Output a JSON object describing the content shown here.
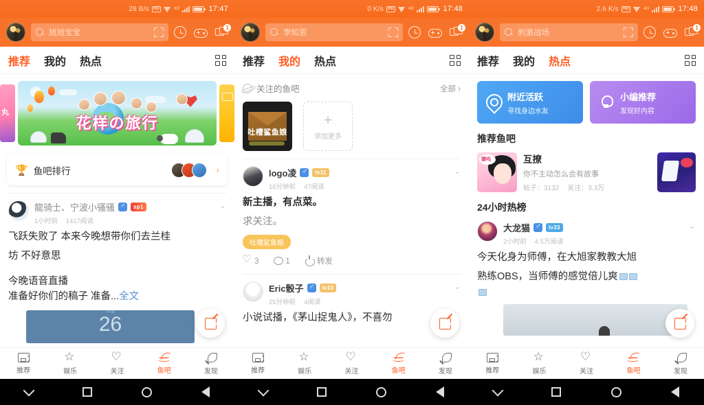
{
  "app": {
    "name": "斗鱼",
    "accent": "#FF5D23",
    "topbar_bg": "#F8732A"
  },
  "panels": [
    {
      "id": "panel-recommend",
      "status": {
        "speed": "28 B/s",
        "hd": "HD",
        "network": "4G",
        "time": "17:47",
        "battery": "88"
      },
      "topbar": {
        "search_placeholder": "旭旭宝宝",
        "message_badge": "1"
      },
      "tabs": [
        {
          "label": "推荐",
          "active": true
        },
        {
          "label": "我的",
          "active": false
        },
        {
          "label": "热点",
          "active": false
        }
      ],
      "banner": {
        "title": "花样の旅行"
      },
      "rank_card": {
        "label": "鱼吧排行",
        "chevron": "›"
      },
      "post": {
        "author": "龍骑士、宁波小骚骚",
        "gender_tag": "♂",
        "level_tag": "sp1",
        "time": "1小时前",
        "reads": "1417阅读",
        "text_line1": "飞跃失败了 本来今晚想带你们去兰桂",
        "text_line2": "坊 不好意思",
        "text_line3": "今晚语音直播",
        "text_line4": "准备好你们的稿子 准备...",
        "more_label": "全文",
        "media_number": "26"
      }
    },
    {
      "id": "panel-mine",
      "status": {
        "speed": "0 K/s",
        "hd": "HD",
        "network": "4G",
        "time": "17:48",
        "battery": "99"
      },
      "topbar": {
        "search_placeholder": "李知恩",
        "message_badge": "1"
      },
      "tabs": [
        {
          "label": "推荐",
          "active": false
        },
        {
          "label": "我的",
          "active": true
        },
        {
          "label": "热点",
          "active": false
        }
      ],
      "followed_bars": {
        "section_title": "关注的鱼吧",
        "all_label": "全部 ›",
        "items": [
          {
            "name": "吐槽鲨鱼娘"
          }
        ],
        "add_label": "添加更多",
        "add_plus": "+"
      },
      "posts": [
        {
          "author": "logo凌",
          "gender_tag": "♂",
          "level_tag": "lv11",
          "time": "16分钟前",
          "reads": "47阅读",
          "text_line1": "新主播，有点菜。",
          "text_line2": "求关注。",
          "bar_pill": "吐槽鲨鱼娘",
          "likes": "3",
          "comments": "1",
          "share_label": "转发"
        },
        {
          "author": "Eric骰子",
          "gender_tag": "♂",
          "level_tag": "lv10",
          "time": "25分钟前",
          "reads": "4阅读",
          "text_line1": "小说试播，《茅山捉鬼人》，不喜勿"
        }
      ]
    },
    {
      "id": "panel-hot",
      "status": {
        "speed": "2.6 K/s",
        "hd": "HD",
        "network": "4G",
        "time": "17:48",
        "battery": "88"
      },
      "topbar": {
        "search_placeholder": "刺激战场",
        "message_badge": "1"
      },
      "tabs": [
        {
          "label": "推荐",
          "active": false
        },
        {
          "label": "我的",
          "active": false
        },
        {
          "label": "热点",
          "active": true
        }
      ],
      "promos": [
        {
          "title": "附近活跃",
          "subtitle": "寻找身边水友",
          "color": "#4fa8f5",
          "icon": "location-pin-icon"
        },
        {
          "title": "小编推荐",
          "subtitle": "发现好内容",
          "color": "#9a6ae8",
          "icon": "lightbulb-icon"
        }
      ],
      "recommend_bars": {
        "section_title": "推荐鱼吧",
        "items": [
          {
            "name": "互撩",
            "desc": "你不主动怎么会有故事",
            "posts_label": "帖子：3132",
            "follows_label": "关注：3.3万"
          }
        ]
      },
      "hot_list": {
        "section_title": "24小时热榜",
        "post": {
          "author": "大龙猫",
          "gender_tag": "♂",
          "level_tag": "lv33",
          "time": "2小时前",
          "reads": "4.5万阅读",
          "text_line1": "今天化身为师傅，在大旭家教教大旭",
          "text_line2": "熟练OBS，当师傅的感觉倍儿爽"
        }
      }
    }
  ],
  "bottom_nav": [
    {
      "label": "推荐",
      "icon": "card-icon",
      "active": false
    },
    {
      "label": "娱乐",
      "icon": "star-icon",
      "active": false
    },
    {
      "label": "关注",
      "icon": "heart-icon",
      "active": false
    },
    {
      "label": "鱼吧",
      "icon": "fish-fin-icon",
      "active": true
    },
    {
      "label": "发现",
      "icon": "rocket-icon",
      "active": false
    }
  ],
  "android_nav": [
    {
      "icon": "chevron-down-icon"
    },
    {
      "icon": "square-recents-icon"
    },
    {
      "icon": "circle-home-icon"
    },
    {
      "icon": "triangle-back-icon"
    }
  ],
  "compose_fab": {
    "icon": "compose-pen-icon"
  }
}
